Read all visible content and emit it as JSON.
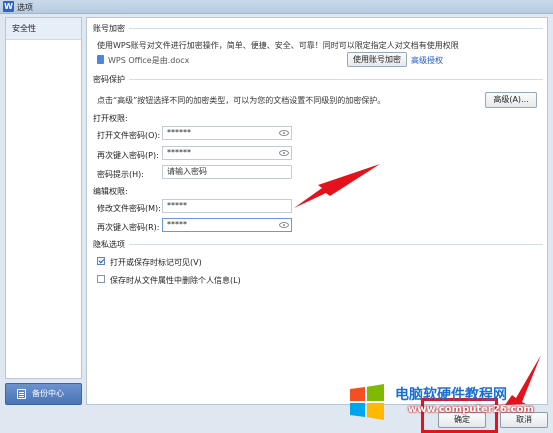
{
  "window": {
    "icon_label": "W",
    "title": "选项",
    "title_faded": "………………………"
  },
  "sidebar": {
    "items": [
      {
        "label": "安全性"
      }
    ],
    "backup_label": "备份中心"
  },
  "account_encrypt": {
    "title": "账号加密",
    "description": "使用WPS账号对文件进行加密操作，简单、便捷、安全、可靠！同时可以限定指定人对文档有使用权限",
    "file_name": "WPS Office是由.docx",
    "use_account_button": "使用账号加密",
    "advanced_auth_link": "高级授权"
  },
  "password_protect": {
    "title": "密码保护",
    "description": "点击“高级”按钮选择不同的加密类型，可以为您的文档设置不同级别的加密保护。",
    "advanced_button": "高级(A)...",
    "open_permission": {
      "title": "打开权限:",
      "open_password_label": "打开文件密码(O):",
      "open_password_value": "******",
      "reenter_label": "再次键入密码(P):",
      "reenter_value": "******",
      "hint_label": "密码提示(H):",
      "hint_placeholder": "请输入密码"
    },
    "edit_permission": {
      "title": "编辑权限:",
      "modify_password_label": "修改文件密码(M):",
      "modify_password_value": "*****",
      "reenter_label": "再次键入密码(R):",
      "reenter_value": "*****"
    }
  },
  "privacy": {
    "title": "隐私选项",
    "options": [
      {
        "label": "打开或保存时标记可见(V)",
        "checked": true
      },
      {
        "label": "保存时从文件属性中删除个人信息(L)",
        "checked": false
      }
    ]
  },
  "footer": {
    "ok_label": "确定",
    "cancel_label": "取消"
  },
  "watermark": {
    "title": "电脑软硬件教程网",
    "url": "www.computer26.com"
  },
  "colors": {
    "accent": "#1a57c4",
    "highlight": "#e4121c",
    "arrow": "#e4121c"
  },
  "icons": [
    "app-logo-icon",
    "document-icon",
    "eye-icon",
    "backup-icon",
    "windows-logo-icon",
    "red-arrow-icon"
  ]
}
